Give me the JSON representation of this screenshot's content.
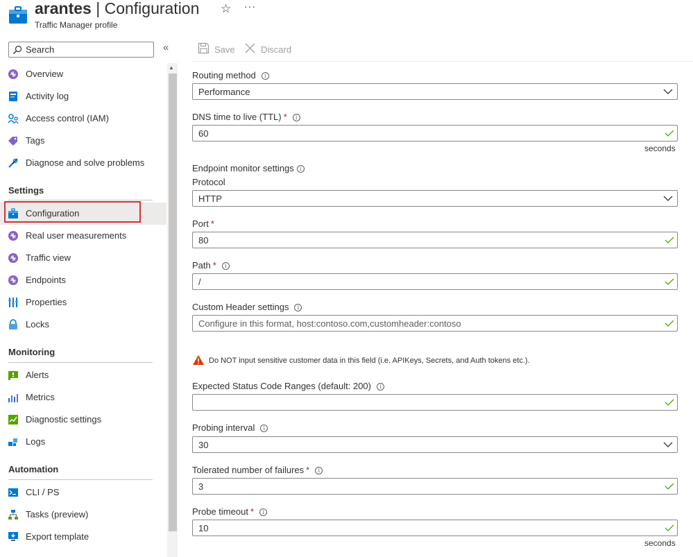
{
  "header": {
    "title_bold": "arantes",
    "title_rest": " | Configuration",
    "subtitle": "Traffic Manager profile",
    "star_glyph": "☆",
    "more_glyph": "···"
  },
  "sidebar": {
    "search_placeholder": "Search",
    "collapse_glyph": "«",
    "items_top": [
      {
        "label": "Overview",
        "icon": "traffic-manager-icon"
      },
      {
        "label": "Activity log",
        "icon": "activity-log-icon"
      },
      {
        "label": "Access control (IAM)",
        "icon": "access-control-icon"
      },
      {
        "label": "Tags",
        "icon": "tag-icon"
      },
      {
        "label": "Diagnose and solve problems",
        "icon": "wrench-icon"
      }
    ],
    "settings_heading": "Settings",
    "settings_items": [
      {
        "label": "Configuration",
        "icon": "configuration-icon"
      },
      {
        "label": "Real user measurements",
        "icon": "traffic-manager-icon"
      },
      {
        "label": "Traffic view",
        "icon": "traffic-manager-icon"
      },
      {
        "label": "Endpoints",
        "icon": "traffic-manager-icon"
      },
      {
        "label": "Properties",
        "icon": "properties-icon"
      },
      {
        "label": "Locks",
        "icon": "lock-icon"
      }
    ],
    "monitoring_heading": "Monitoring",
    "monitoring_items": [
      {
        "label": "Alerts",
        "icon": "alerts-icon"
      },
      {
        "label": "Metrics",
        "icon": "metrics-icon"
      },
      {
        "label": "Diagnostic settings",
        "icon": "diagnostic-settings-icon"
      },
      {
        "label": "Logs",
        "icon": "logs-icon"
      }
    ],
    "automation_heading": "Automation",
    "automation_items": [
      {
        "label": "CLI / PS",
        "icon": "cli-icon"
      },
      {
        "label": "Tasks (preview)",
        "icon": "tasks-icon"
      },
      {
        "label": "Export template",
        "icon": "export-template-icon"
      }
    ],
    "active_item": "Configuration"
  },
  "toolbar": {
    "save_label": "Save",
    "discard_label": "Discard"
  },
  "form": {
    "routing_method": {
      "label": "Routing method",
      "value": "Performance"
    },
    "dns_ttl": {
      "label": "DNS time to live (TTL)",
      "value": "60",
      "units": "seconds"
    },
    "endpoint_monitor_heading": "Endpoint monitor settings",
    "protocol": {
      "label": "Protocol",
      "value": "HTTP"
    },
    "port": {
      "label": "Port",
      "value": "80"
    },
    "path": {
      "label": "Path",
      "value": "/"
    },
    "custom_header": {
      "label": "Custom Header settings",
      "placeholder": "Configure in this format, host:contoso.com,customheader:contoso"
    },
    "warning": "Do NOT input sensitive customer data in this field (i.e. APIKeys, Secrets, and Auth tokens etc.).",
    "status_code_ranges": {
      "label": "Expected Status Code Ranges (default: 200)",
      "value": ""
    },
    "probing_interval": {
      "label": "Probing interval",
      "value": "30"
    },
    "tolerated_failures": {
      "label": "Tolerated number of failures",
      "value": "3"
    },
    "probe_timeout": {
      "label": "Probe timeout",
      "value": "10",
      "units": "seconds"
    },
    "required_marker": "*",
    "info_glyph": "i"
  },
  "colors": {
    "accent": "#0078d4",
    "required": "#a4262c",
    "valid_check": "#57a300",
    "highlight_box": "#d13438",
    "warning": "#d83b01"
  }
}
